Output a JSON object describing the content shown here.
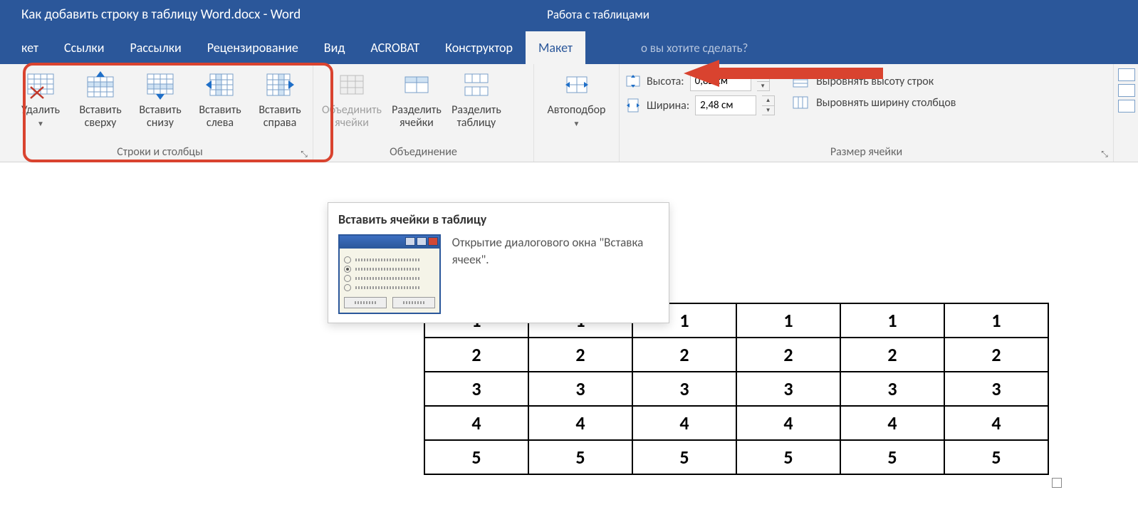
{
  "title": "Как добавить строку в таблицу Word.docx - Word",
  "context_title": "Работа с таблицами",
  "tabs": {
    "t0": "кет",
    "t1": "Ссылки",
    "t2": "Рассылки",
    "t3": "Рецензирование",
    "t4": "Вид",
    "t5": "ACROBAT",
    "t6": "Конструктор",
    "t7": "Макет"
  },
  "tell_me": "о вы хотите сделать?",
  "rows_cols": {
    "delete": "Удалить",
    "insert_above": "Вставить\nсверху",
    "insert_below": "Вставить\nснизу",
    "insert_left": "Вставить\nслева",
    "insert_right": "Вставить\nсправа",
    "group": "Строки и столбцы"
  },
  "merge": {
    "merge_cells": "Объединить\nячейки",
    "split_cells": "Разделить\nячейки",
    "split_table": "Разделить\nтаблицу",
    "group": "Объединение"
  },
  "autofit": {
    "label": "Автоподбор"
  },
  "cell_size": {
    "height_label": "Высота:",
    "height_value": "0,82 см",
    "width_label": "Ширина:",
    "width_value": "2,48 см",
    "distribute_rows": "Выровнять высоту строк",
    "distribute_cols": "Выровнять ширину столбцов",
    "group": "Размер ячейки"
  },
  "tooltip": {
    "title": "Вставить ячейки в таблицу",
    "desc": "Открытие диалогового окна \"Вставка ячеек\"."
  },
  "table": {
    "rows": [
      [
        "1",
        "1",
        "1",
        "1",
        "1",
        "1"
      ],
      [
        "2",
        "2",
        "2",
        "2",
        "2",
        "2"
      ],
      [
        "3",
        "3",
        "3",
        "3",
        "3",
        "3"
      ],
      [
        "4",
        "4",
        "4",
        "4",
        "4",
        "4"
      ],
      [
        "5",
        "5",
        "5",
        "5",
        "5",
        "5"
      ]
    ]
  }
}
